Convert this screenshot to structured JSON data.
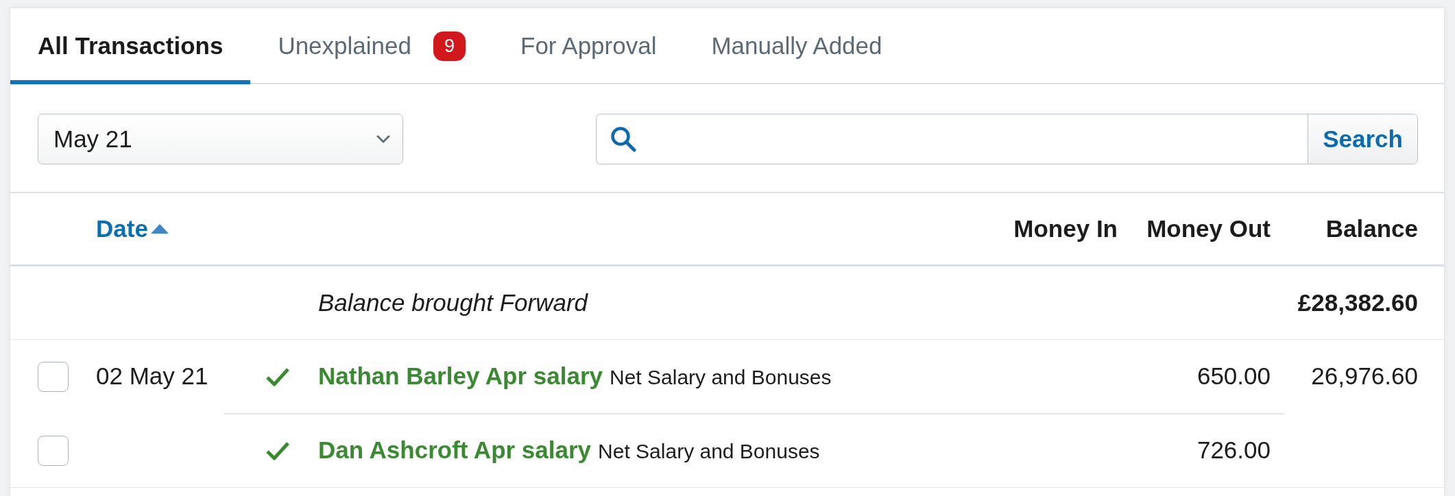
{
  "tabs": [
    {
      "label": "All Transactions",
      "selected": true
    },
    {
      "label": "Unexplained",
      "selected": false,
      "badge": "9"
    },
    {
      "label": "For Approval",
      "selected": false
    },
    {
      "label": "Manually Added",
      "selected": false
    }
  ],
  "filters": {
    "period": {
      "value": "May 21"
    },
    "search": {
      "button": "Search"
    }
  },
  "table": {
    "columns": [
      {
        "label": "Date",
        "sort_ascending": true
      },
      {
        "label": "Money In"
      },
      {
        "label": "Money Out"
      },
      {
        "label": "Balance"
      }
    ],
    "opening": {
      "label": "Balance brought Forward",
      "balance": "£28,382.60"
    },
    "rows": [
      {
        "checked": false,
        "date": "02 May 21",
        "explained": true,
        "description": "Nathan Barley Apr salary",
        "category": "Net Salary and Bonuses",
        "money_out": "650.00",
        "balance": "26,976.60"
      },
      {
        "checked": false,
        "explained": true,
        "description": "Dan Ashcroft Apr salary",
        "category": "Net Salary and Bonuses",
        "money_out": "726.00"
      }
    ]
  }
}
